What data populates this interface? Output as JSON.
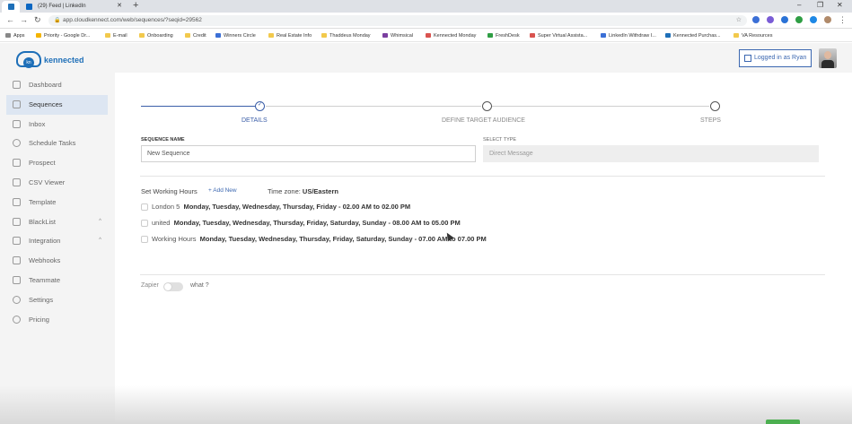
{
  "browser": {
    "tabs": [
      {
        "label": "",
        "icon": "kennected-favicon"
      },
      {
        "label": "(29) Feed | LinkedIn",
        "icon": "linkedin-favicon"
      }
    ],
    "url": "app.cloudkennect.com/web/sequences/?seqid=29562",
    "bookmarks": [
      "Apps",
      "Priority - Google Dr...",
      "E-mail",
      "Onboarding",
      "Credit",
      "Winners Circle",
      "Real Estate Info",
      "Thaddeus Monday",
      "Whimsical",
      "Kennected Monday",
      "FreshDesk",
      "Super Virtual Assista...",
      "LinkedIn Withdraw I...",
      "Kennected Purchas...",
      "VA Resources"
    ]
  },
  "app": {
    "brand": "kennected",
    "brand_badge": "kn",
    "login_label": "Logged in as Ryan"
  },
  "sidebar": {
    "items": [
      {
        "label": "Dashboard",
        "icon": "monitor-icon"
      },
      {
        "label": "Sequences",
        "icon": "list-icon"
      },
      {
        "label": "Inbox",
        "icon": "chat-icon"
      },
      {
        "label": "Schedule Tasks",
        "icon": "clock-icon"
      },
      {
        "label": "Prospect",
        "icon": "user-icon"
      },
      {
        "label": "CSV Viewer",
        "icon": "file-icon"
      },
      {
        "label": "Template",
        "icon": "template-icon"
      },
      {
        "label": "BlackList",
        "icon": "blacklist-icon"
      },
      {
        "label": "Integration",
        "icon": "integration-icon"
      },
      {
        "label": "Webhooks",
        "icon": "webhook-icon"
      },
      {
        "label": "Teammate",
        "icon": "team-icon"
      },
      {
        "label": "Settings",
        "icon": "gear-icon"
      },
      {
        "label": "Pricing",
        "icon": "dollar-icon"
      }
    ]
  },
  "stepper": {
    "steps": [
      "DETAILS",
      "DEFINE TARGET AUDIENCE",
      "STEPS"
    ]
  },
  "form": {
    "sequence_name_label": "SEQUENCE NAME",
    "sequence_name_value": "New Sequence",
    "select_type_label": "SELECT TYPE",
    "select_type_value": "Direct Message"
  },
  "working_hours": {
    "title": "Set Working Hours",
    "add_new": "+ Add New",
    "timezone_label": "Time zone:",
    "timezone_value": "US/Eastern",
    "schedules": [
      {
        "name": "London 5",
        "days": "Monday, Tuesday, Wednesday, Thursday, Friday - 02.00 AM to 02.00 PM"
      },
      {
        "name": "united",
        "days": "Monday, Tuesday, Wednesday, Thursday, Friday, Saturday, Sunday - 08.00 AM to 05.00 PM"
      },
      {
        "name": "Working Hours",
        "days": "Monday, Tuesday, Wednesday, Thursday, Friday, Saturday, Sunday - 07.00 AM to 07.00 PM"
      }
    ]
  },
  "zapier": {
    "label": "Zapier",
    "help": "what ?",
    "enabled": false
  },
  "colors": {
    "accent": "#3b5ea8",
    "brand": "#1e6fb8",
    "sidebar_bg": "#f4f4f4",
    "active_nav_bg": "#dde6f2"
  }
}
